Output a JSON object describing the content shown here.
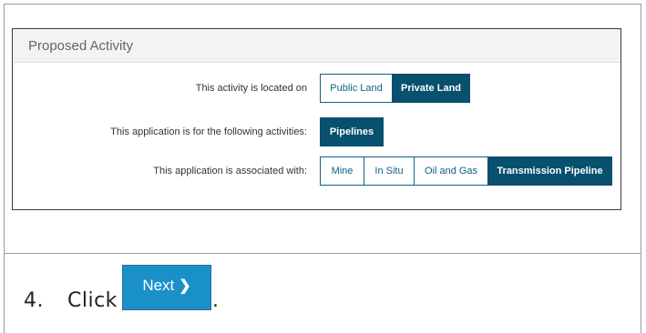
{
  "panel": {
    "title": "Proposed Activity",
    "rows": [
      {
        "label": "This activity is located on",
        "options": [
          {
            "label": "Public Land",
            "active": false
          },
          {
            "label": "Private Land",
            "active": true
          }
        ]
      },
      {
        "label": "This application is for the following activities:",
        "options": [
          {
            "label": "Pipelines",
            "active": true
          }
        ]
      },
      {
        "label": "This application is associated with:",
        "options": [
          {
            "label": "Mine",
            "active": false
          },
          {
            "label": "In Situ",
            "active": false
          },
          {
            "label": "Oil and Gas",
            "active": false
          },
          {
            "label": "Transmission Pipeline",
            "active": true
          }
        ]
      }
    ]
  },
  "instruction": {
    "step_number": "4.",
    "text": "Click",
    "button_label": "Next",
    "button_icon": "chevron-right-icon",
    "period": "."
  },
  "colors": {
    "accent_dark": "#07506e",
    "accent_border": "#0e6385",
    "next_button": "#1991c8"
  }
}
